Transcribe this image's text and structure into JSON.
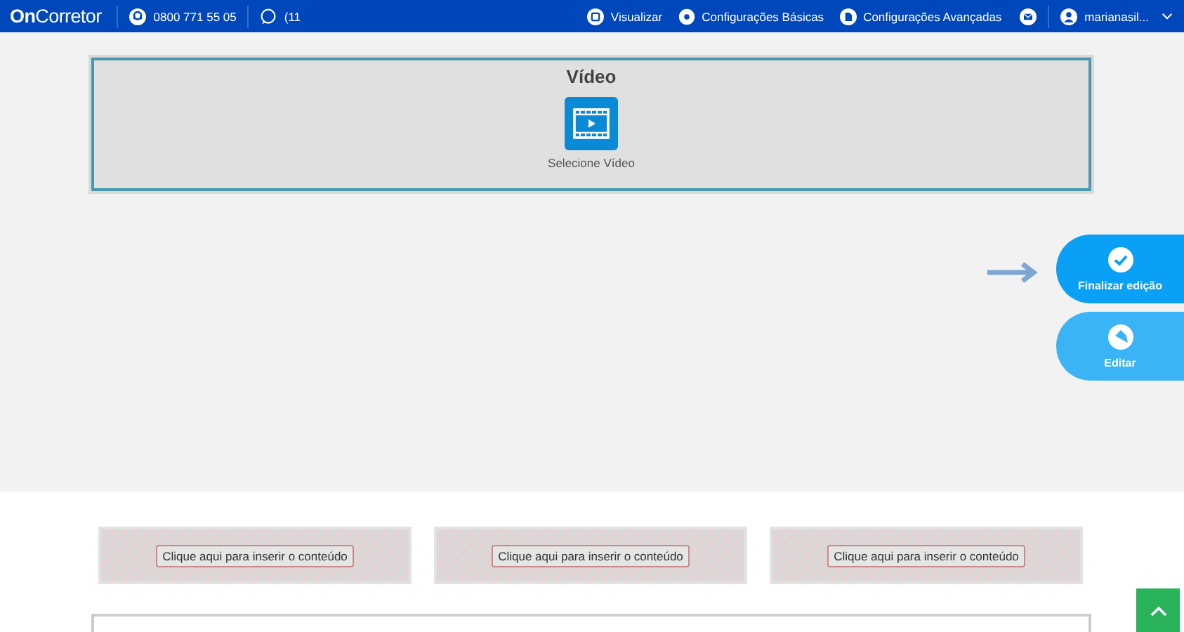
{
  "navbar": {
    "logo": "**On**Corretor",
    "phone": "0800 771 55 05",
    "whatsapp": "(11",
    "items": [
      {
        "kind": "preview",
        "label": "Visualizar"
      },
      {
        "kind": "settings",
        "label": "Configurações Básicas"
      },
      {
        "kind": "document",
        "label": "Configurações Avançadas"
      }
    ],
    "user": "marianasil..."
  },
  "video_block": {
    "title": "Vídeo",
    "label": "Selecione Vídeo"
  },
  "side_actions": [
    {
      "kind": "check",
      "label": "Finalizar edição",
      "selected": true
    },
    {
      "kind": "edit",
      "label": "Editar",
      "selected": false
    }
  ],
  "placeholders": [
    "Clique aqui para inserir o conteúdo",
    "Clique aqui para inserir o conteúdo",
    "Clique aqui para inserir o conteúdo"
  ]
}
